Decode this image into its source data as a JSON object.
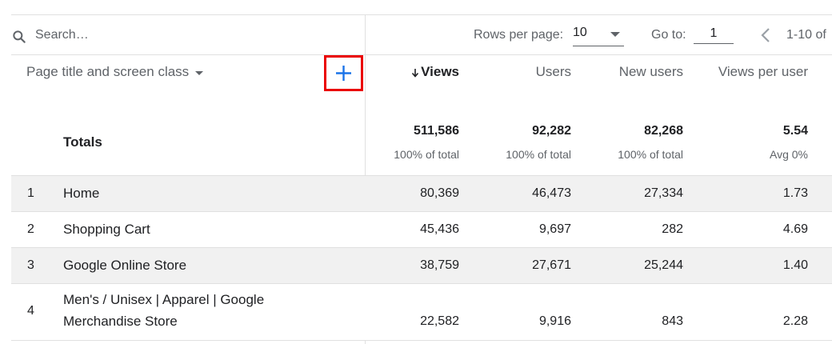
{
  "search": {
    "placeholder": "Search…"
  },
  "pagination": {
    "rows_label": "Rows per page:",
    "rows_value": "10",
    "goto_label": "Go to:",
    "goto_value": "1",
    "range": "1-10 of"
  },
  "columns": {
    "dimension": "Page title and screen class",
    "views": "Views",
    "users": "Users",
    "new_users": "New users",
    "views_per_user": "Views per user"
  },
  "totals": {
    "label": "Totals",
    "views": "511,586",
    "views_sub": "100% of total",
    "users": "92,282",
    "users_sub": "100% of total",
    "new_users": "82,268",
    "new_users_sub": "100% of total",
    "views_per_user": "5.54",
    "views_per_user_sub": "Avg 0%"
  },
  "rows": [
    {
      "rank": "1",
      "name": "Home",
      "views": "80,369",
      "users": "46,473",
      "new_users": "27,334",
      "views_per_user": "1.73"
    },
    {
      "rank": "2",
      "name": "Shopping Cart",
      "views": "45,436",
      "users": "9,697",
      "new_users": "282",
      "views_per_user": "4.69"
    },
    {
      "rank": "3",
      "name": "Google Online Store",
      "views": "38,759",
      "users": "27,671",
      "new_users": "25,244",
      "views_per_user": "1.40"
    },
    {
      "rank": "4",
      "name_line1": "Men's / Unisex | Apparel | Google",
      "name_line2": "Merchandise Store",
      "views": "22,582",
      "users": "9,916",
      "new_users": "843",
      "views_per_user": "2.28"
    }
  ],
  "colors": {
    "accent": "#1a73e8",
    "highlight_border": "#ea0000",
    "row_alt": "#f1f1f1",
    "divider": "#e0e0e0"
  }
}
